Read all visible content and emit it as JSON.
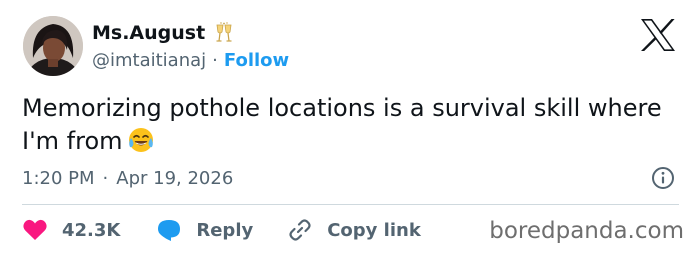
{
  "author": {
    "display_name": "Ms.August",
    "name_emoji": "clinking-glasses-icon",
    "handle": "@imtaitianaj",
    "separator": "·",
    "follow_label": "Follow"
  },
  "platform_logo": "x-logo-icon",
  "tweet": {
    "text": "Memorizing pothole locations is a survival skill where I'm from",
    "emoji": "face-with-tears-of-joy-icon"
  },
  "meta": {
    "time": "1:20 PM",
    "separator": "·",
    "date": "Apr 19, 2026"
  },
  "actions": {
    "likes_count": "42.3K",
    "reply_label": "Reply",
    "copy_label": "Copy link"
  },
  "watermark": "boredpanda.com",
  "colors": {
    "accent": "#1d9bf0",
    "like": "#f91880",
    "text_primary": "#0f1419",
    "text_secondary": "#536471",
    "divider": "#cfd9de"
  }
}
